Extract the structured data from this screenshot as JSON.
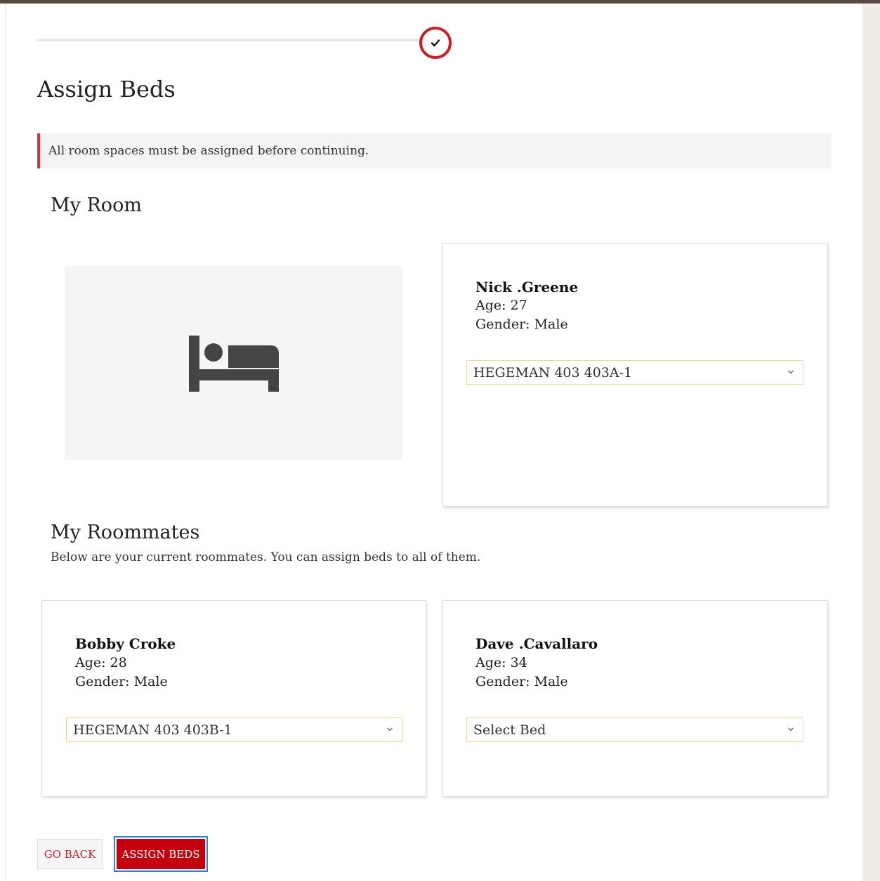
{
  "header": {
    "title": "Assign Beds"
  },
  "progress": {
    "step_state": "completed",
    "icon": "check-icon",
    "accent_color": "#cc1f2b"
  },
  "notice": {
    "text": "All room spaces must be assigned before continuing.",
    "accent_color": "#d9303f"
  },
  "my_room": {
    "title": "My Room",
    "image_icon": "bed-icon",
    "occupant": {
      "name": "Nick .Greene",
      "age_line": "Age: 27",
      "gender_line": "Gender: Male",
      "bed_selected": "HEGEMAN 403 403A-1"
    }
  },
  "roommates": {
    "title": "My Roommates",
    "subtitle": "Below are your current roommates. You can assign beds to all of them.",
    "items": [
      {
        "name": "Bobby Croke",
        "age_line": "Age: 28",
        "gender_line": "Gender: Male",
        "bed_selected": "HEGEMAN 403 403B-1"
      },
      {
        "name": "Dave .Cavallaro",
        "age_line": "Age: 34",
        "gender_line": "Gender: Male",
        "bed_selected": "Select Bed"
      }
    ]
  },
  "actions": {
    "back_label": "GO BACK",
    "assign_label": "ASSIGN BEDS",
    "primary_color": "#c5000e"
  }
}
